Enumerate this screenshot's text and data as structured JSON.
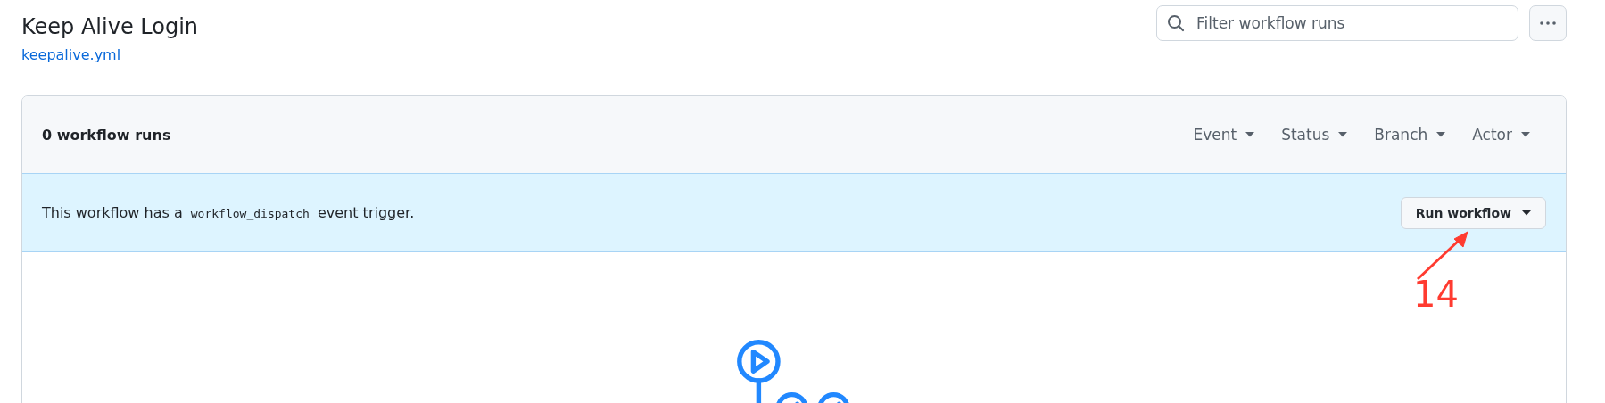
{
  "header": {
    "title": "Keep Alive Login",
    "file_link": "keepalive.yml"
  },
  "search": {
    "placeholder": "Filter workflow runs"
  },
  "runs": {
    "count_label": "0 workflow runs",
    "filters": [
      {
        "label": "Event"
      },
      {
        "label": "Status"
      },
      {
        "label": "Branch"
      },
      {
        "label": "Actor"
      }
    ]
  },
  "banner": {
    "text_before": "This workflow has a",
    "code": "workflow_dispatch",
    "text_after": "event trigger.",
    "button": "Run workflow"
  },
  "annotation": {
    "label": "14"
  }
}
